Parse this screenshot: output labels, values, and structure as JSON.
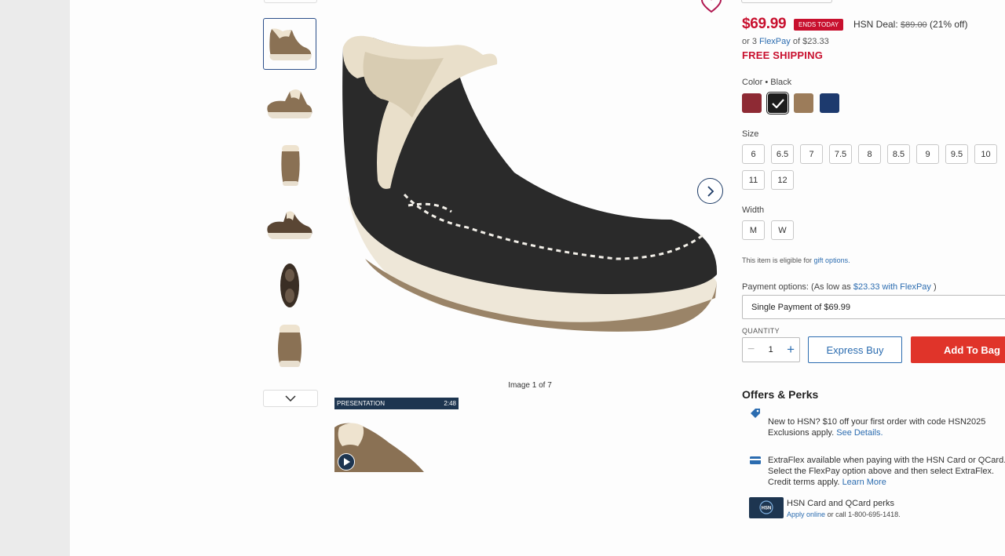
{
  "product": {
    "price": "$69.99",
    "ends_today": "ENDS TODAY",
    "deal_prefix": "HSN Deal:",
    "deal_original": "$89.00",
    "deal_discount": "(21% off)",
    "flexpay_prefix": "or 3",
    "flexpay_link": "FlexPay",
    "flexpay_suffix": "of $23.33",
    "free_shipping": "FREE SHIPPING",
    "color_label": "Color • Black",
    "colors": [
      {
        "name": "red",
        "hex": "#8e2a34",
        "selected": false
      },
      {
        "name": "black",
        "hex": "#1d1d1d",
        "selected": true
      },
      {
        "name": "taupe",
        "hex": "#9c7c5a",
        "selected": false
      },
      {
        "name": "navy",
        "hex": "#1d3a6e",
        "selected": false
      }
    ],
    "size_label": "Size",
    "sizes": [
      "6",
      "6.5",
      "7",
      "7.5",
      "8",
      "8.5",
      "9",
      "9.5",
      "10",
      "11",
      "12"
    ],
    "width_label": "Width",
    "widths": [
      "M",
      "W"
    ],
    "gift_prefix": "This item is eligible for",
    "gift_link": "gift options.",
    "payment_label_prefix": "Payment options: (As low as",
    "payment_label_link": "$23.33 with FlexPay",
    "payment_label_suffix": ")",
    "payment_selected": "Single Payment of $69.99",
    "quantity_label": "QUANTITY",
    "quantity": "1",
    "express_buy": "Express Buy",
    "add_to_bag": "Add To Bag"
  },
  "gallery": {
    "image_counter": "Image 1 of 7",
    "video_label": "PRESENTATION",
    "video_duration": "2:48"
  },
  "offers": {
    "title": "Offers & Perks",
    "perk1_line1": "New to HSN? $10 off your first order with code HSN2025",
    "perk1_line2": "Exclusions apply.",
    "perk1_link": "See Details.",
    "perk2_line1": "ExtraFlex available when paying with the HSN Card or QCard.",
    "perk2_line2": "Select the FlexPay option above and then select ExtraFlex.",
    "perk2_line3": "Credit terms apply.",
    "perk2_link": "Learn More",
    "card_title": "HSN Card and QCard perks",
    "card_link": "Apply online",
    "card_suffix": "or call 1-800-695-1418.",
    "card_logo_text": "HSN"
  }
}
